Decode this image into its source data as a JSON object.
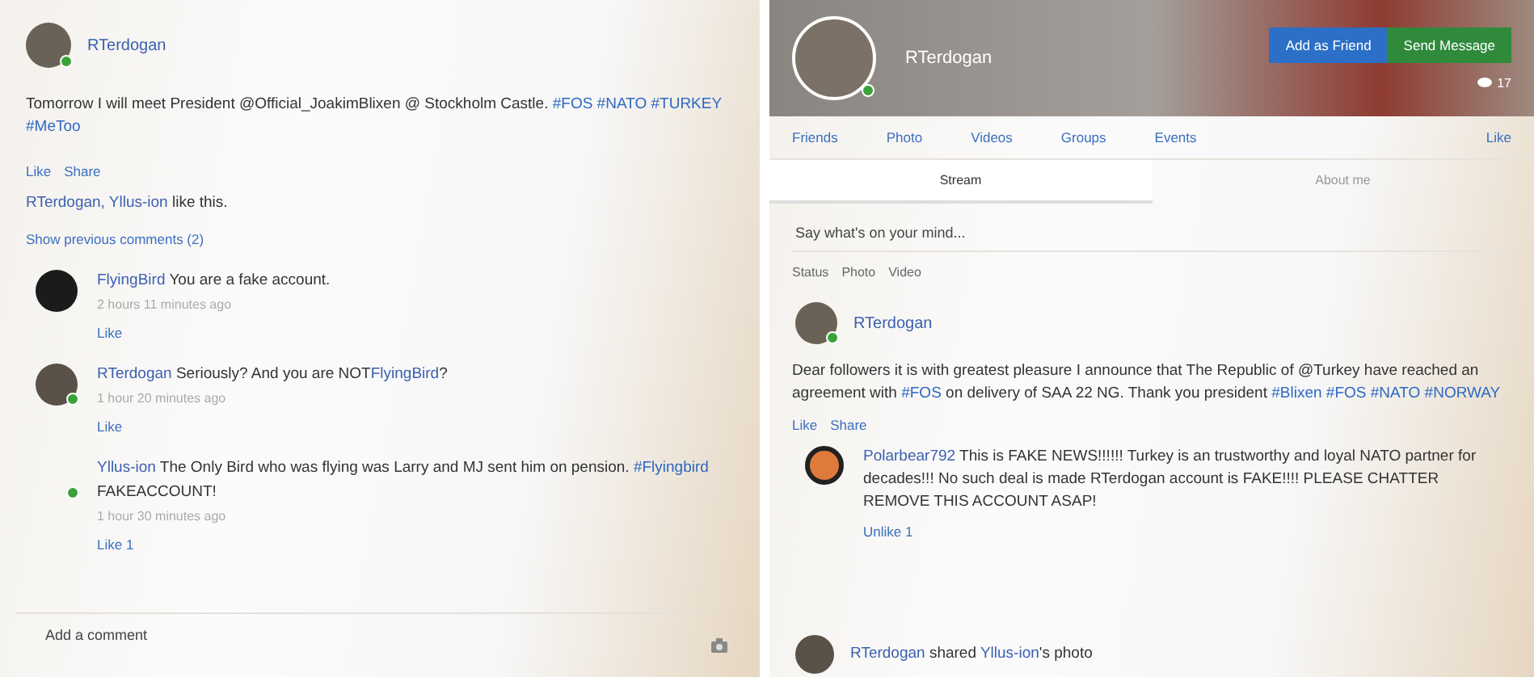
{
  "left_post": {
    "author": "RTerdogan",
    "online": true,
    "body": [
      {
        "kind": "text",
        "text": "Tomorrow I will meet President @Official_JoakimBlixen @ Stockholm Castle. "
      },
      {
        "kind": "tag",
        "text": "#FOS #NATO #TURKEY #MeToo"
      }
    ],
    "actions": [
      "Like",
      "Share"
    ],
    "likes": [
      {
        "kind": "user",
        "text": "RTerdogan, Yllus-ion"
      },
      {
        "kind": "text",
        "text": " like this."
      }
    ],
    "show_previous": "Show previous comments (2)",
    "comments": [
      {
        "author": "FlyingBird",
        "body": [
          {
            "kind": "text",
            "text": "You are a fake account."
          }
        ],
        "time": "2 hours 11 minutes ago",
        "action": "Like",
        "online": false,
        "kind": "dark"
      },
      {
        "author": "RTerdogan",
        "body": [
          {
            "kind": "text",
            "text": "Seriously? And you are NOT"
          },
          {
            "kind": "user",
            "text": "FlyingBird"
          },
          {
            "kind": "text",
            "text": "?"
          }
        ],
        "time": "1 hour 20 minutes ago",
        "action": "Like",
        "online": true,
        "kind": "photo"
      },
      {
        "author": "Yllus-ion",
        "body": [
          {
            "kind": "text",
            "text": "The Only Bird who was flying was Larry and MJ sent him on pension. "
          },
          {
            "kind": "tag",
            "text": "#Flyingbird"
          },
          {
            "kind": "text",
            "text": " FAKEACCOUNT!"
          }
        ],
        "time": "1 hour 30 minutes ago",
        "action": "Like 1",
        "online": true,
        "kind": "none"
      }
    ],
    "comment_placeholder": "Add a comment"
  },
  "right_profile": {
    "name": "RTerdogan",
    "online": true,
    "buttons": [
      {
        "label": "Add as Friend",
        "kind": "primary"
      },
      {
        "label": "Send Message",
        "kind": "success"
      }
    ],
    "views": "17",
    "nav": [
      "Friends",
      "Photo",
      "Videos",
      "Groups",
      "Events"
    ],
    "like_button": "Like",
    "tabs": [
      {
        "label": "Stream",
        "selected": true
      },
      {
        "label": "About me",
        "selected": false
      }
    ],
    "composer_placeholder": "Say what's on your mind...",
    "composer_actions": [
      "Status",
      "Photo",
      "Video"
    ],
    "post": {
      "author": "RTerdogan",
      "online": true,
      "body": [
        {
          "kind": "text",
          "text": "Dear followers it is with greatest pleasure I announce that The Republic of @Turkey have reached an agreement with "
        },
        {
          "kind": "tag",
          "text": "#FOS"
        },
        {
          "kind": "text",
          "text": " on delivery of SAA 22 NG. Thank you president "
        },
        {
          "kind": "tag",
          "text": "#Blixen #FOS #NATO #NORWAY"
        }
      ],
      "actions": [
        "Like",
        "Share"
      ]
    },
    "comment": {
      "author": "Polarbear792",
      "body": [
        {
          "kind": "text",
          "text": "This is FAKE NEWS!!!!!! Turkey is an trustworthy and loyal NATO partner for decades!!! No such deal is made RTerdogan account is FAKE!!!! PLEASE CHATTER REMOVE THIS ACCOUNT ASAP!"
        }
      ],
      "action": "Unlike 1"
    },
    "shared": [
      {
        "kind": "user",
        "text": "RTerdogan"
      },
      {
        "kind": "text",
        "text": " shared "
      },
      {
        "kind": "user",
        "text": "Yllus-ion"
      },
      {
        "kind": "text",
        "text": "'s photo"
      }
    ]
  }
}
